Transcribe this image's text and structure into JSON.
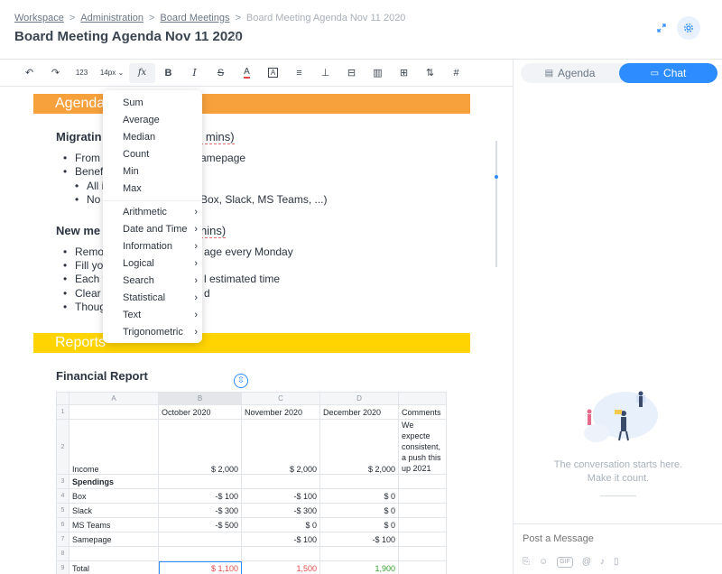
{
  "breadcrumb": {
    "items": [
      "Workspace",
      "Administration",
      "Board Meetings"
    ],
    "current": "Board Meeting Agenda Nov 11 2020",
    "separator": ">"
  },
  "page": {
    "title": "Board Meeting Agenda Nov 11 2020"
  },
  "toolbar": {
    "number_format": "123",
    "font_size": "14px",
    "fx": "fx",
    "bold": "B",
    "italic": "I",
    "strike": "S"
  },
  "document": {
    "agenda_heading": "Agenda",
    "section1": {
      "title": "Migratin",
      "rest": "0 mins)",
      "bullets": [
        "From r",
        "amepage",
        "Benefi",
        "All i",
        "No",
        "Box, Slack, MS Teams, ...)"
      ]
    },
    "section2": {
      "title": "New me",
      "rest": "nins)",
      "bullets": [
        "Remot",
        "age every Monday",
        "Fill you",
        "Each t",
        "l estimated time",
        "Clear a",
        "d",
        "Thoug"
      ]
    },
    "reports_heading": "Reports",
    "financial_title": "Financial Report"
  },
  "function_menu": {
    "basic": [
      "Sum",
      "Average",
      "Median",
      "Count",
      "Min",
      "Max"
    ],
    "categories": [
      "Arithmetic",
      "Date and Time",
      "Information",
      "Logical",
      "Search",
      "Statistical",
      "Text",
      "Trigonometric"
    ]
  },
  "spreadsheet": {
    "columns": [
      "A",
      "B",
      "C",
      "D",
      ""
    ],
    "header_row": [
      "",
      "October 2020",
      "November 2020",
      "December 2020",
      "Comments"
    ],
    "comment_text": "We expecte consistent, a push this up 2021",
    "rows": [
      [
        "Income",
        "$ 2,000",
        "$ 2,000",
        "$ 2,000"
      ],
      [
        "Spendings",
        "",
        "",
        ""
      ],
      [
        "Box",
        "-$ 100",
        "-$ 100",
        "$ 0"
      ],
      [
        "Slack",
        "-$ 300",
        "-$ 300",
        "$ 0"
      ],
      [
        "MS Teams",
        "-$ 500",
        "$ 0",
        "$ 0"
      ],
      [
        "Samepage",
        "",
        "-$ 100",
        "-$ 100"
      ],
      [
        "",
        "",
        "",
        ""
      ],
      [
        "Total",
        "$ 1,100",
        "1,500",
        "1,900"
      ]
    ],
    "row_numbers": [
      "1",
      "2",
      "3",
      "4",
      "5",
      "6",
      "7",
      "8",
      "9"
    ]
  },
  "right_panel": {
    "tabs": [
      "Agenda",
      "Chat"
    ],
    "active_tab": "Chat",
    "empty_line1": "The conversation starts here.",
    "empty_line2": "Make it count.",
    "compose_placeholder": "Post a Message",
    "gif_label": "GIF"
  },
  "colors": {
    "accent": "#2d8cff",
    "agenda_bar": "#f7a13c",
    "reports_bar": "#ffd400"
  }
}
